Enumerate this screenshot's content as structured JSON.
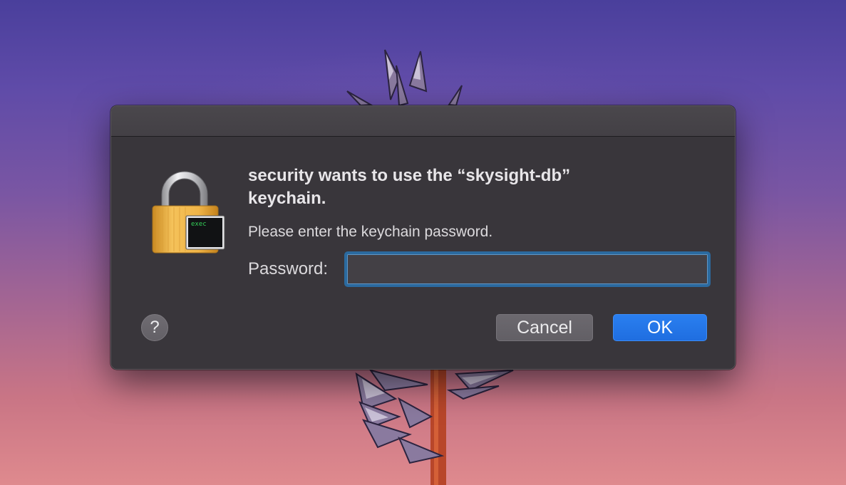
{
  "dialog": {
    "title": "security wants to use the “skysight-db” keychain.",
    "message": "Please enter the keychain password.",
    "password_label": "Password:",
    "password_value": "",
    "help_label": "?",
    "cancel_label": "Cancel",
    "ok_label": "OK"
  },
  "icon": {
    "name": "keychain-lock-icon",
    "badge_text": "exec"
  },
  "colors": {
    "accent": "#1f6ee0",
    "focus_ring": "#2b6a9f",
    "dialog_bg": "#39363b"
  }
}
